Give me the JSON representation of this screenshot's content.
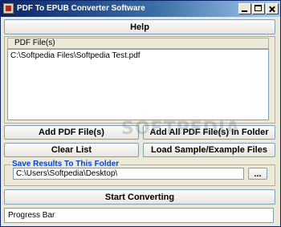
{
  "window": {
    "title": "PDF To EPUB Converter Software"
  },
  "help_button": "Help",
  "file_list": {
    "header": "PDF File(s)",
    "items": [
      "C:\\Softpedia Files\\Softpedia Test.pdf"
    ]
  },
  "buttons": {
    "add_files": "Add PDF File(s)",
    "add_folder": "Add All PDF File(s) In Folder",
    "clear_list": "Clear List",
    "load_sample": "Load Sample/Example Files",
    "browse": "...",
    "start": "Start Converting"
  },
  "output": {
    "legend": "Save Results To This Folder",
    "path": "C:\\Users\\Softpedia\\Desktop\\"
  },
  "progress": {
    "label": "Progress Bar"
  },
  "watermark": "SOFTPEDIA"
}
